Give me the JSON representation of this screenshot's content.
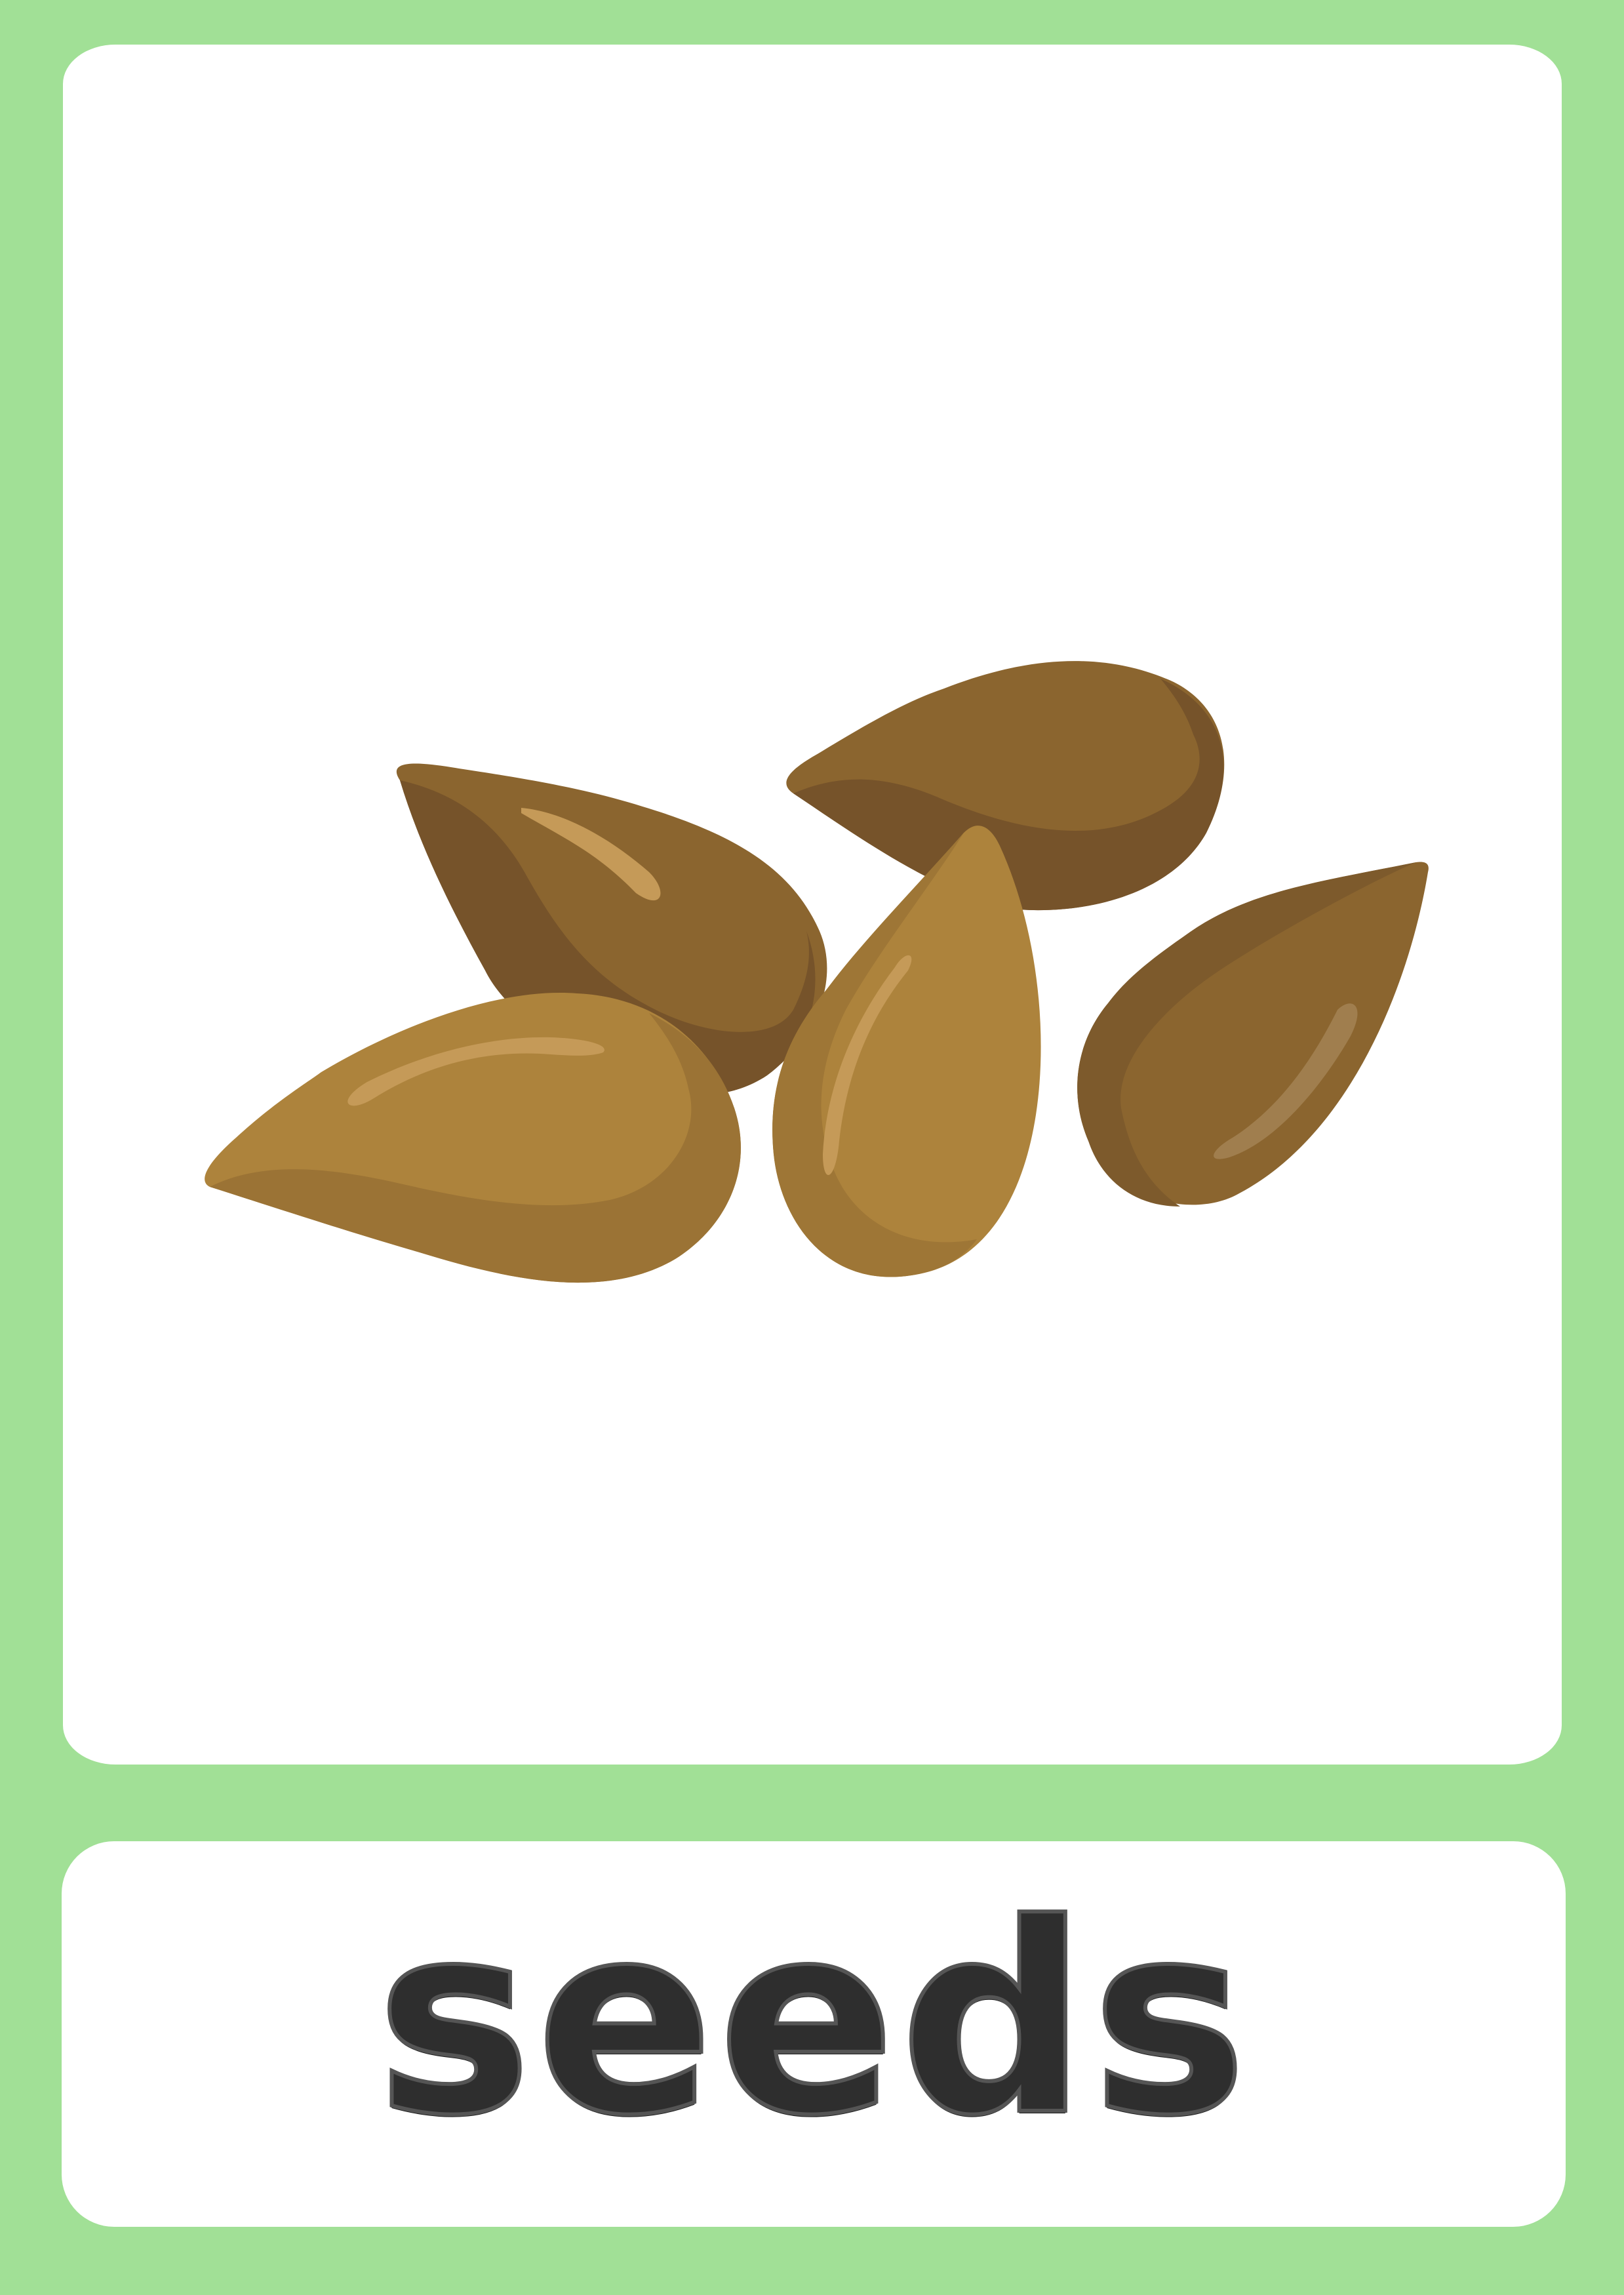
{
  "card": {
    "word": "seeds",
    "picture_icon": "seeds-illustration",
    "colors": {
      "border": "#a1e096",
      "panel": "#ffffff",
      "text": "#2e2e2e",
      "seed_dark": "#76532a",
      "seed_mid": "#8b652f",
      "seed_light": "#ad833c",
      "highlight": "#c59a58"
    }
  }
}
